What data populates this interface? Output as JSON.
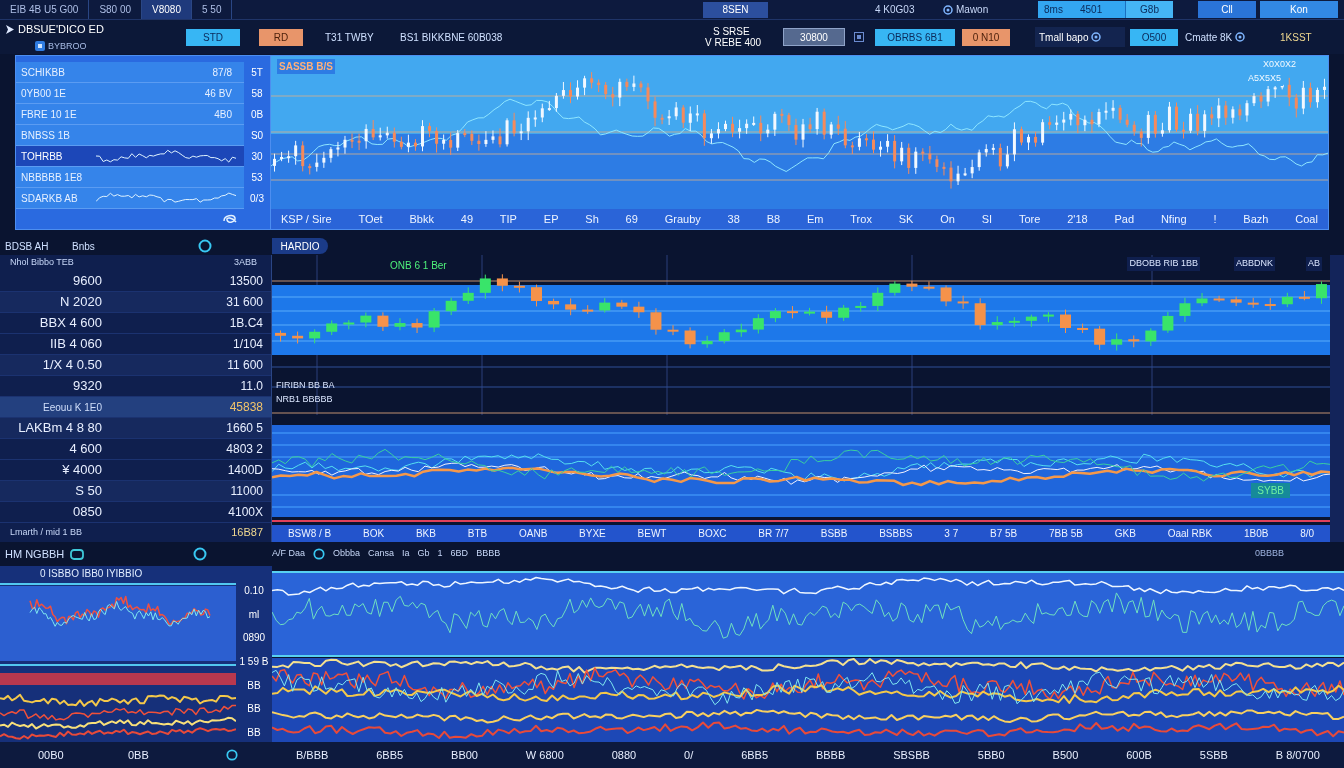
{
  "top_bar": {
    "tabs": [
      {
        "label": "EIB 4B U5 G00",
        "selected": false
      },
      {
        "label": "S80 00",
        "selected": false
      },
      {
        "label": "V8080",
        "selected": true
      },
      {
        "label": "5 50",
        "selected": false
      }
    ],
    "center_tab": "8SEN",
    "status": [
      "4 K0G03",
      "Mawon"
    ],
    "quote": {
      "symbol": "8ms",
      "price": "4501",
      "change": "G8b"
    },
    "buttons": [
      "Cll",
      "Kon"
    ]
  },
  "header": {
    "brand": "DBSUE'DICO ED",
    "subtitle": "BYBROO",
    "actions": [
      {
        "label": "STD",
        "kind": "primary"
      },
      {
        "label": "RD",
        "kind": "warning"
      }
    ],
    "stats": [
      "T31 TWBY",
      "BS1 BIKKBNE 60B038"
    ],
    "quote_lines": [
      "S SRSE",
      "V REBE 400"
    ],
    "price_field": "30800",
    "order_buttons": [
      {
        "label": "OBRBS 6B1",
        "kind": "primary"
      },
      {
        "label": "0 N10",
        "kind": "warning"
      }
    ],
    "account": {
      "name": "Tmall bapo",
      "button": "O500",
      "balance": "Cmatte 8K",
      "badge": "1KSST"
    }
  },
  "overview": {
    "rows": [
      {
        "label": "SCHIKBB",
        "value": "87/8",
        "kind": "text",
        "selected": false
      },
      {
        "label": "0YB00 1E",
        "value": "46 BV",
        "kind": "text",
        "selected": false
      },
      {
        "label": "FBRE 10 1E",
        "value": "4B0",
        "kind": "text",
        "selected": false
      },
      {
        "label": "BNBSS 1B",
        "kind": "text",
        "selected": false
      },
      {
        "label": "TOHRBB",
        "kind": "chart",
        "selected": true
      },
      {
        "label": "NBBBBB 1E8",
        "kind": "text",
        "selected": false
      },
      {
        "label": "SDARKB AB",
        "kind": "chart",
        "selected": false
      }
    ],
    "axis": [
      "5T",
      "58",
      "0B",
      "S0",
      "30",
      "53",
      "0/3"
    ],
    "chart": {
      "title": "SASSB B/S",
      "corner": [
        "X0X0X2",
        "A5X5X5"
      ],
      "xlabels": [
        "KSP / Sire",
        "TOet",
        "Bbkk",
        "49",
        "TIP",
        "EP",
        "Sh",
        "69",
        "Grauby",
        "38",
        "B8",
        "Em",
        "Trox",
        "SK",
        "On",
        "SI",
        "Tore",
        "2'18",
        "Pad",
        "Nfing",
        "!",
        "Bazh",
        "Coal"
      ]
    }
  },
  "watchlist": {
    "header": [
      "BDSB AH",
      "Bnbs"
    ],
    "columns": [
      "Nhol Bibbo TEB",
      "3ABB"
    ],
    "rows": [
      {
        "label": "9600",
        "value": "13500",
        "selected": false
      },
      {
        "label": "N 2020",
        "value": "31 600",
        "selected": false
      },
      {
        "label": "BBX 4 600",
        "value": "1B.C4",
        "selected": false
      },
      {
        "label": "IIB 4 060",
        "value": "1/104",
        "selected": false
      },
      {
        "label": "1/X 4 0.50",
        "value": "11 600",
        "selected": false
      },
      {
        "label": "9320",
        "value": "11.0",
        "selected": false
      },
      {
        "label": "Eeouu K 1E0",
        "value": "45838",
        "selected": true
      },
      {
        "label": "LAKBm 4 8 80",
        "value": "1660 5",
        "selected": false
      },
      {
        "label": "4 600",
        "value": "4803 2",
        "selected": false
      },
      {
        "label": "¥ 4000",
        "value": "1400D",
        "selected": false
      },
      {
        "label": "S 50",
        "value": "11000",
        "selected": false
      },
      {
        "label": "0850",
        "value": "4100X",
        "selected": false
      }
    ],
    "footer": [
      "Lmarth / mid 1 BB",
      "16B87"
    ],
    "chart": {
      "tab": "HARDIO",
      "legend": "ONB 6 1 Ber",
      "corner": [
        "DBOBB RIB 1BB",
        "ABBDNK",
        "AB"
      ],
      "notes": [
        "FIRIBN BB BA",
        "NRB1 BBBBB"
      ],
      "badge": "SYBB",
      "xlabels": [
        "BSW8 / B",
        "BOK",
        "BKB",
        "BTB",
        "OANB",
        "BYXE",
        "BEWT",
        "BOXC",
        "BR 7/7",
        "BSBB",
        "BSBBS",
        "3 7",
        "B7 5B",
        "7BB 5B",
        "GKB",
        "Oaal RBK",
        "1B0B",
        "8/0"
      ]
    }
  },
  "depth": {
    "title": "HM NGBBH",
    "chart_header": [
      "A/F Daa",
      "Obbba",
      "Cansa",
      "Ia",
      "Gb",
      "1",
      "6BD",
      "BBBB"
    ],
    "corner": "0BBBB",
    "mini_title": "0 ISBBO IBB0 IYIBBIO",
    "mini_axis": [
      "0.10",
      "ml",
      "0890",
      "1 59 B",
      "BB",
      "BB",
      "BB"
    ],
    "left_xlabels": [
      "00B0",
      "0BB"
    ],
    "xlabels": [
      "B/BBB",
      "6BB5",
      "BB00",
      "W 6800",
      "0880",
      "0/",
      "6BB5",
      "BBBB",
      "SBSBB",
      "5BB0",
      "B500",
      "600B",
      "5SBB",
      "B 8/0700"
    ]
  }
}
